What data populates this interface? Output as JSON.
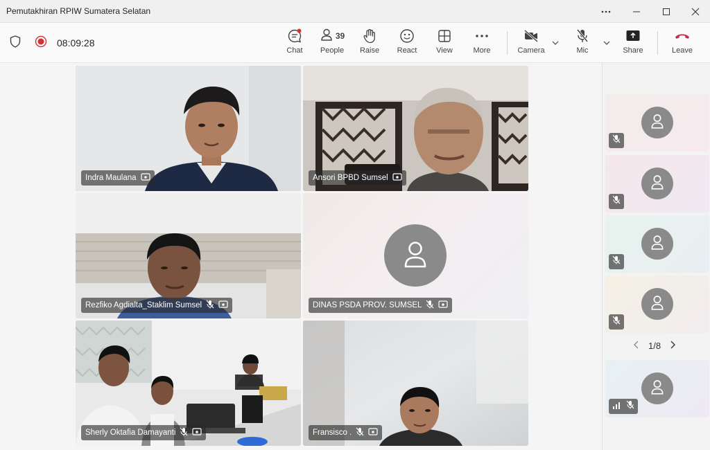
{
  "window": {
    "title": "Pemutakhiran RPIW Sumatera Selatan"
  },
  "toolbar": {
    "timer": "08:09:28",
    "chat": "Chat",
    "people": "People",
    "people_count": "39",
    "raise": "Raise",
    "react": "React",
    "view": "View",
    "more": "More",
    "camera": "Camera",
    "mic": "Mic",
    "share": "Share",
    "leave": "Leave"
  },
  "participants": [
    {
      "name": "Indra Maulana"
    },
    {
      "name": "Ansori BPBD Sumsel"
    },
    {
      "name": "Rezfiko Agdialta_Staklim Sumsel"
    },
    {
      "name": "DINAS PSDA PROV. SUMSEL"
    },
    {
      "name": "Sherly Oktafia Damayanti"
    },
    {
      "name": "Fransisco ."
    }
  ],
  "rail": {
    "pager": "1/8"
  },
  "colors": {
    "accent": "#5b5fc7",
    "leave": "#c4314b",
    "record": "#d13438"
  }
}
